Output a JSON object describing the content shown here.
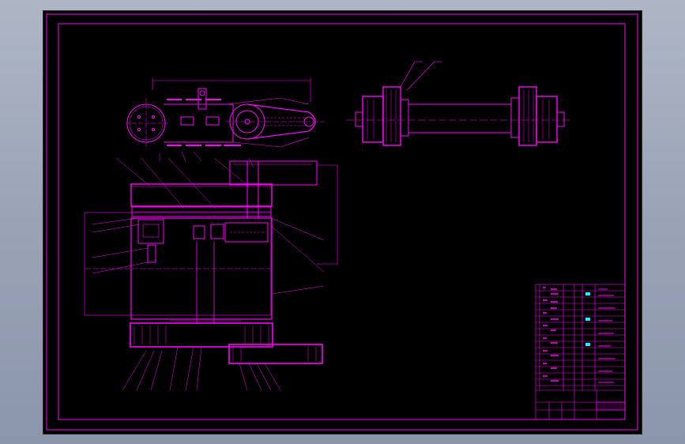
{
  "colors": {
    "background": "#000000",
    "line": "#ff00ff",
    "accent": "#00ffff",
    "frame": "#ff00ff"
  },
  "title_block": {
    "rows_left": [
      "",
      "",
      "",
      "",
      "",
      "",
      "",
      "",
      "",
      "",
      "",
      "",
      "",
      "",
      "",
      ""
    ],
    "rows_right": [
      "",
      "",
      "",
      "",
      "",
      "",
      "",
      "",
      "",
      "",
      "",
      ""
    ]
  }
}
